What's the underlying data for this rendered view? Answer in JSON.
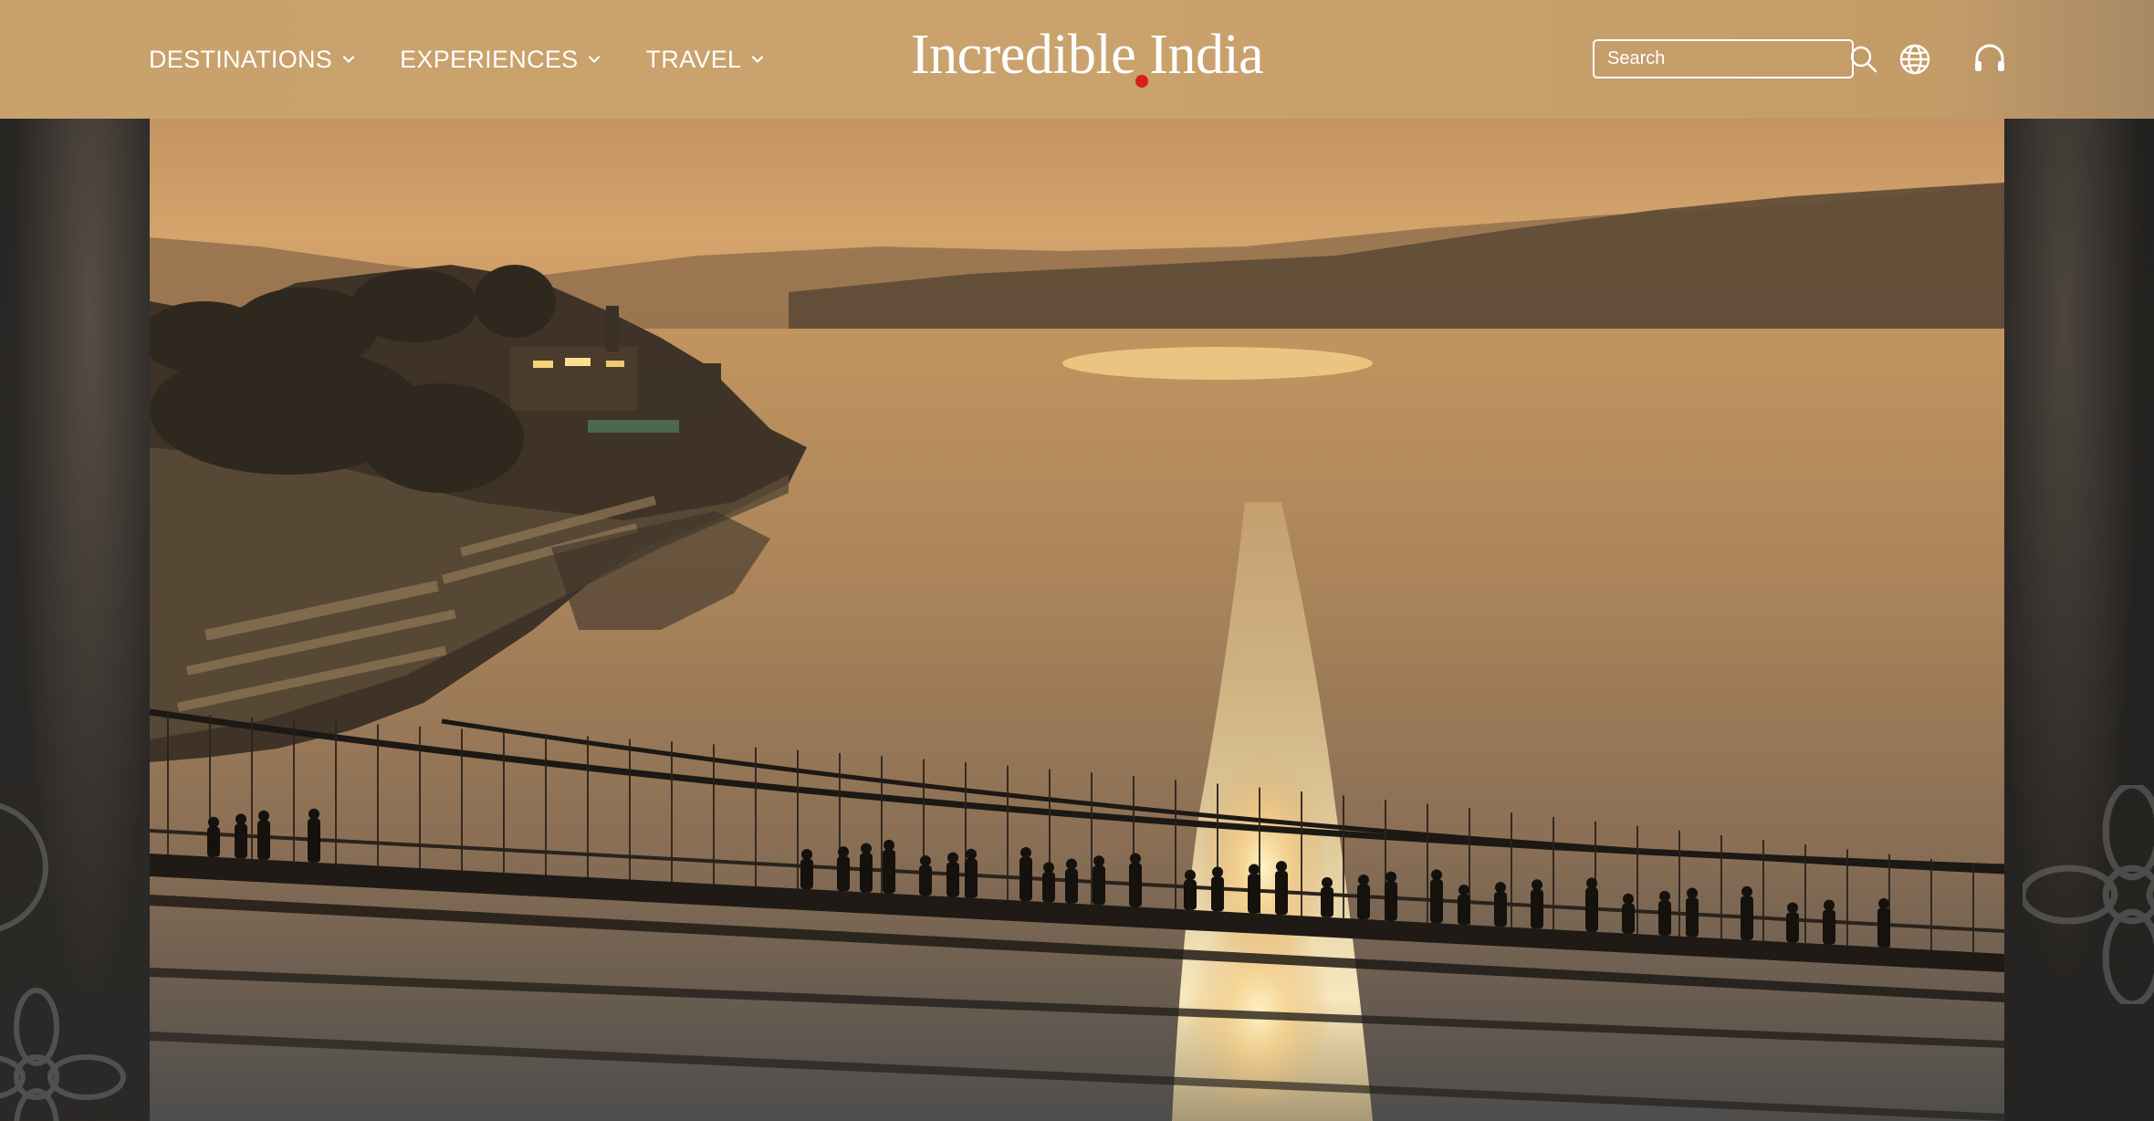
{
  "nav": {
    "items": [
      {
        "label": "DESTINATIONS"
      },
      {
        "label": "EXPERIENCES"
      },
      {
        "label": "TRAVEL"
      }
    ]
  },
  "logo": {
    "text": "Incredible India"
  },
  "search": {
    "placeholder": "Search"
  },
  "icons": {
    "search": "search-icon",
    "language": "globe-icon",
    "support": "headset-icon",
    "dropdown": "chevron-down-icon"
  },
  "colors": {
    "header": "#c9a16c",
    "logo_dot": "#d81e1e",
    "text": "#ffffff"
  },
  "hero": {
    "image": "sunset-river-suspension-bridge"
  }
}
